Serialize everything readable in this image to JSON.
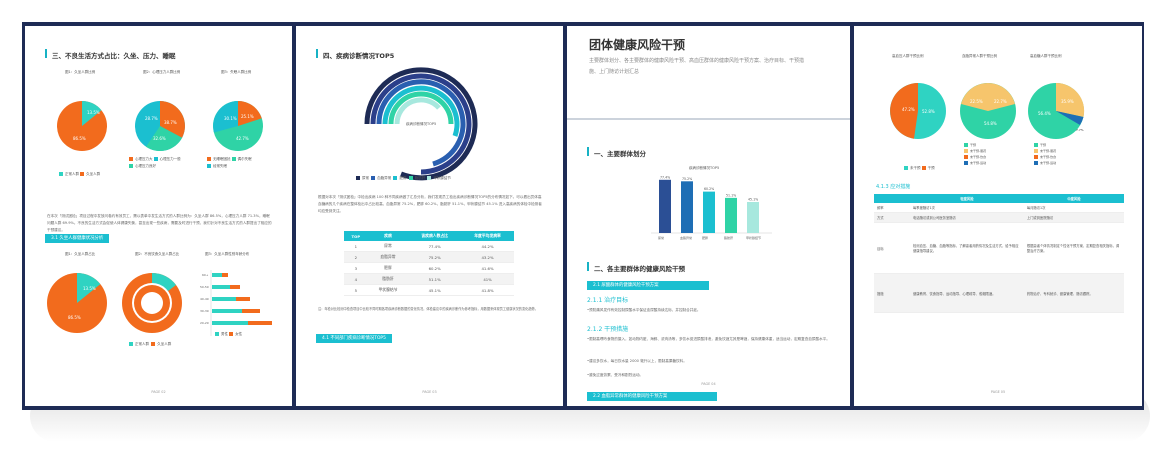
{
  "page1": {
    "section_title": "三、不良生活方式占比：久坐、压力、睡眠",
    "chart_titles": [
      "图1：久坐人群比例",
      "图2：心理压力人群比例",
      "图3：失眠人群比例"
    ],
    "pie1_labels": [
      "13.5%",
      "86.5%"
    ],
    "pie2_labels": [
      "28.7%",
      "38.7%",
      "32.6%"
    ],
    "pie3_labels": [
      "30.1%",
      "25.1%",
      "42.7%"
    ],
    "legend1": [
      "正常人群",
      "久坐人群"
    ],
    "legend2": [
      "心理压力大",
      "心理压力一般",
      "心理压力良好"
    ],
    "legend3": [
      "无睡眠困扰",
      "偶尔失眠",
      "经常失眠"
    ],
    "body_text": "在本次「测试团检」项目过程中发放问卷约有效员工，需以表单中发生活方式的人群比例为：久坐人群 86.5%，心理压力人群 71.3%，睡眠问题人群 69.9%。不良的生活方式会促使人体健康失衡，甚至出现一些疾病，需要及时进行干预，我们针对不良生活方式的人群提出了相应的干预建议。",
    "pill": "3.1 久坐人群健康状况分析",
    "chart_titles_b": [
      "图1：久坐人群占比",
      "图2：不良饮食久坐人群占比",
      "图3：久坐人群性别年龄分布"
    ],
    "pie4_labels": [
      "13.5%",
      "86.5%"
    ],
    "hbar_cats": [
      "60+",
      "50-59",
      "40-49",
      "30-39",
      "20-29"
    ],
    "legend_b": [
      "正常人群",
      "久坐人群"
    ],
    "legend_c": [
      "男性",
      "女性"
    ],
    "page_num": "PAGE 02"
  },
  "page2": {
    "section_title": "四、疾病诊断情况TOP5",
    "donut_center": "疾病诊断情况TOP5",
    "legend": [
      "尿常",
      "血脂异常",
      "肥胖",
      "脂肪肝",
      "甲状腺结节"
    ],
    "body_text": "根据对本次「测试团检」中检出疾病 100 种不同疾病做了汇总分析，我们发现员工检出疾病诊断情况TOP5的分布情况如下。可以看出员体高血糖病的几个疾病在整体检出中占比较高，血脂异常 75.2%，肥胖 60.2%，脂肪肝 51.1%，甲状腺结节 45.1% 进入高疾病的体检中检测者均应受到关注。",
    "table_headers": [
      "TOP",
      "疾病",
      "该疾病人数占比",
      "年度平均发病率"
    ],
    "table_rows": [
      [
        "1",
        "尿常",
        "77.4%",
        "44.2%"
      ],
      [
        "2",
        "血脂异常",
        "75.2%",
        "43.2%"
      ],
      [
        "3",
        "肥胖",
        "60.2%",
        "41.6%"
      ],
      [
        "4",
        "脂肪肝",
        "51.1%",
        "41%"
      ],
      [
        "5",
        "甲状腺结节",
        "45.1%",
        "41.8%"
      ]
    ],
    "note": "注：年检对比检测中检查项目中比较不同时期各项疾病诊断数据的变化情况，体检建议中的疾病诊断作为参考指标，用数据来体现员工健康状况的变化趋势。",
    "pill": "4.1 不同部门疾病诊断情况TOP5",
    "page_num": "PAGE 03"
  },
  "page3": {
    "title": "团体健康风险干预",
    "subtitle": "主要群体划分、各主要群体的健康风险干预、高血压群体的健康风险干预方案、治疗目标、干预措施、上门随访计划汇总",
    "sec1": "一、主要群体划分",
    "chart_title": "疾病诊断情况TOP5",
    "bar_values": [
      77.4,
      75.2,
      60.2,
      51.1,
      45.1
    ],
    "bar_labels": [
      "77.4%",
      "75.2%",
      "60.2%",
      "51.1%",
      "45.1%"
    ],
    "bar_cats": [
      "尿常",
      "血脂异常",
      "肥胖",
      "脂肪肝",
      "甲状腺结节"
    ],
    "sec2": "二、各主要群体的健康风险干预",
    "pill1": "2.1 尿酸群体的健康风险干预方案",
    "h1": "2.1.1 治疗目标",
    "t1": "•预防痛风发作有效控制尿酸水平保证血尿酸持续达标，并控制合并症。",
    "h2": "2.1.2 干预措施",
    "t2": "•限制高嘌呤食物的摄入，如动物内脏、海鲜、浓肉汤等，多饮水促进尿酸排泄，避免饮酒尤其是啤酒，保持健康体重，适当运动，定期复查血尿酸水平。",
    "t3": "•建议多饮水，每日饮水量 2000 毫升以上，限制高果糖饮料。",
    "t4": "•避免过度劳累、受冷和剧烈运动。",
    "pill2": "2.2 血脂异常群体的健康风险干预方案",
    "page_num": "PAGE 04"
  },
  "page4": {
    "chart_titles": [
      "高血压人群干预比例",
      "血脂异常人群干预比例",
      "高血糖人群干预比例"
    ],
    "pie1_labels": [
      "47.2%",
      "52.8%"
    ],
    "pie2_labels": [
      "22.5%",
      "22.7%",
      "54.8%"
    ],
    "pie3_labels": [
      "35.9%",
      "56.4%",
      "7.7%"
    ],
    "legend1": [
      "未干预",
      "干预"
    ],
    "legend2": [
      "干预",
      "未干预-服药",
      "未干预-饮食",
      "未干预-运动"
    ],
    "legend3": [
      "干预",
      "未干预-服药",
      "未干预-饮食",
      "未干预-运动"
    ],
    "teal_head": "4.1.3 应对措施",
    "table_headers": [
      "",
      "轻度风险",
      "中度风险"
    ],
    "table_rows": [
      [
        "频率",
        "每季度随访1次",
        "每月随访1次"
      ],
      [
        "方式",
        "电话随访或到公司医务室随访",
        "上门或到医院随访"
      ],
      [
        "目标",
        "检测血压、血糖、血脂等指标，了解患者用药情况及生活方式，给予相应健康指导建议。",
        "根据患者个体情况制定个性化干预方案，定期复查相关指标，调整治疗方案。"
      ],
      [
        "措施",
        "健康教育、饮食指导、运动指导、心理疏导、戒烟限酒。",
        "药物治疗、专科就诊、健康管理、随访跟踪。"
      ]
    ],
    "page_num": "PAGE 05"
  },
  "colors": {
    "teal": "#1bbfd0",
    "orange": "#f26b1d",
    "navy": "#1e2b55",
    "green": "#2fd3a6",
    "yellow": "#f6c56c",
    "blue": "#1e6eb5"
  }
}
